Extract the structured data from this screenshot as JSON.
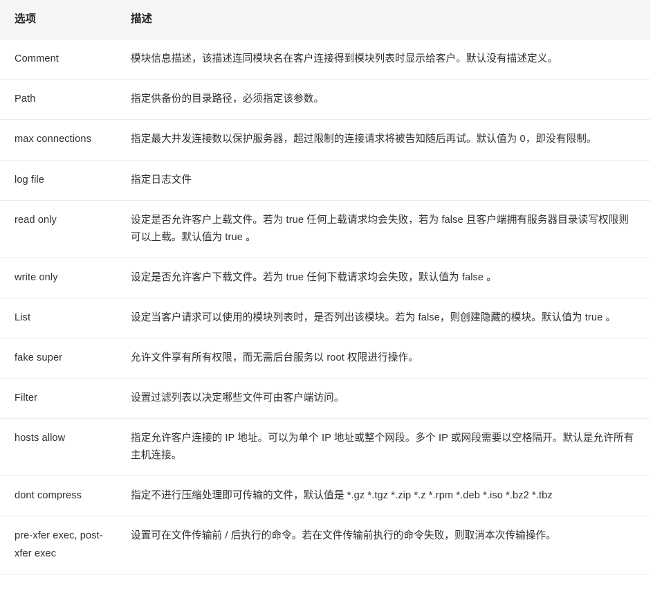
{
  "table": {
    "headers": {
      "option": "选项",
      "description": "描述"
    },
    "rows": [
      {
        "option": "Comment",
        "description": "模块信息描述，该描述连同模块名在客户连接得到模块列表时显示给客户。默认没有描述定义。"
      },
      {
        "option": "Path",
        "description": "指定供备份的目录路径，必须指定该参数。"
      },
      {
        "option": "max connections",
        "description": "指定最大并发连接数以保护服务器，超过限制的连接请求将被告知随后再试。默认值为 0，即没有限制。"
      },
      {
        "option": "log file",
        "description": "指定日志文件"
      },
      {
        "option": "read only",
        "description": "设定是否允许客户上载文件。若为 true 任何上载请求均会失败，若为 false 且客户端拥有服务器目录读写权限则可以上载。默认值为 true 。"
      },
      {
        "option": "write only",
        "description": "设定是否允许客户下载文件。若为 true 任何下载请求均会失败，默认值为 false 。"
      },
      {
        "option": "List",
        "description": "设定当客户请求可以使用的模块列表时，是否列出该模块。若为 false，则创建隐藏的模块。默认值为 true 。"
      },
      {
        "option": "fake super",
        "description": "允许文件享有所有权限，而无需后台服务以 root 权限进行操作。"
      },
      {
        "option": "Filter",
        "description": "设置过滤列表以决定哪些文件可由客户端访问。"
      },
      {
        "option": "hosts allow",
        "description": "指定允许客户连接的 IP 地址。可以为单个 IP 地址或整个网段。多个 IP 或网段需要以空格隔开。默认是允许所有主机连接。"
      },
      {
        "option": "dont compress",
        "description": "指定不进行压缩处理即可传输的文件，默认值是 *.gz *.tgz *.zip *.z *.rpm *.deb *.iso *.bz2 *.tbz"
      },
      {
        "option": "pre-xfer exec, post-xfer exec",
        "description": "设置可在文件传输前 / 后执行的命令。若在文件传输前执行的命令失败，则取消本次传输操作。"
      }
    ]
  },
  "colors": {
    "header_background": "#f6f6f7",
    "text": "#2f3033",
    "divider": "#ececee",
    "page_background": "#ffffff"
  }
}
